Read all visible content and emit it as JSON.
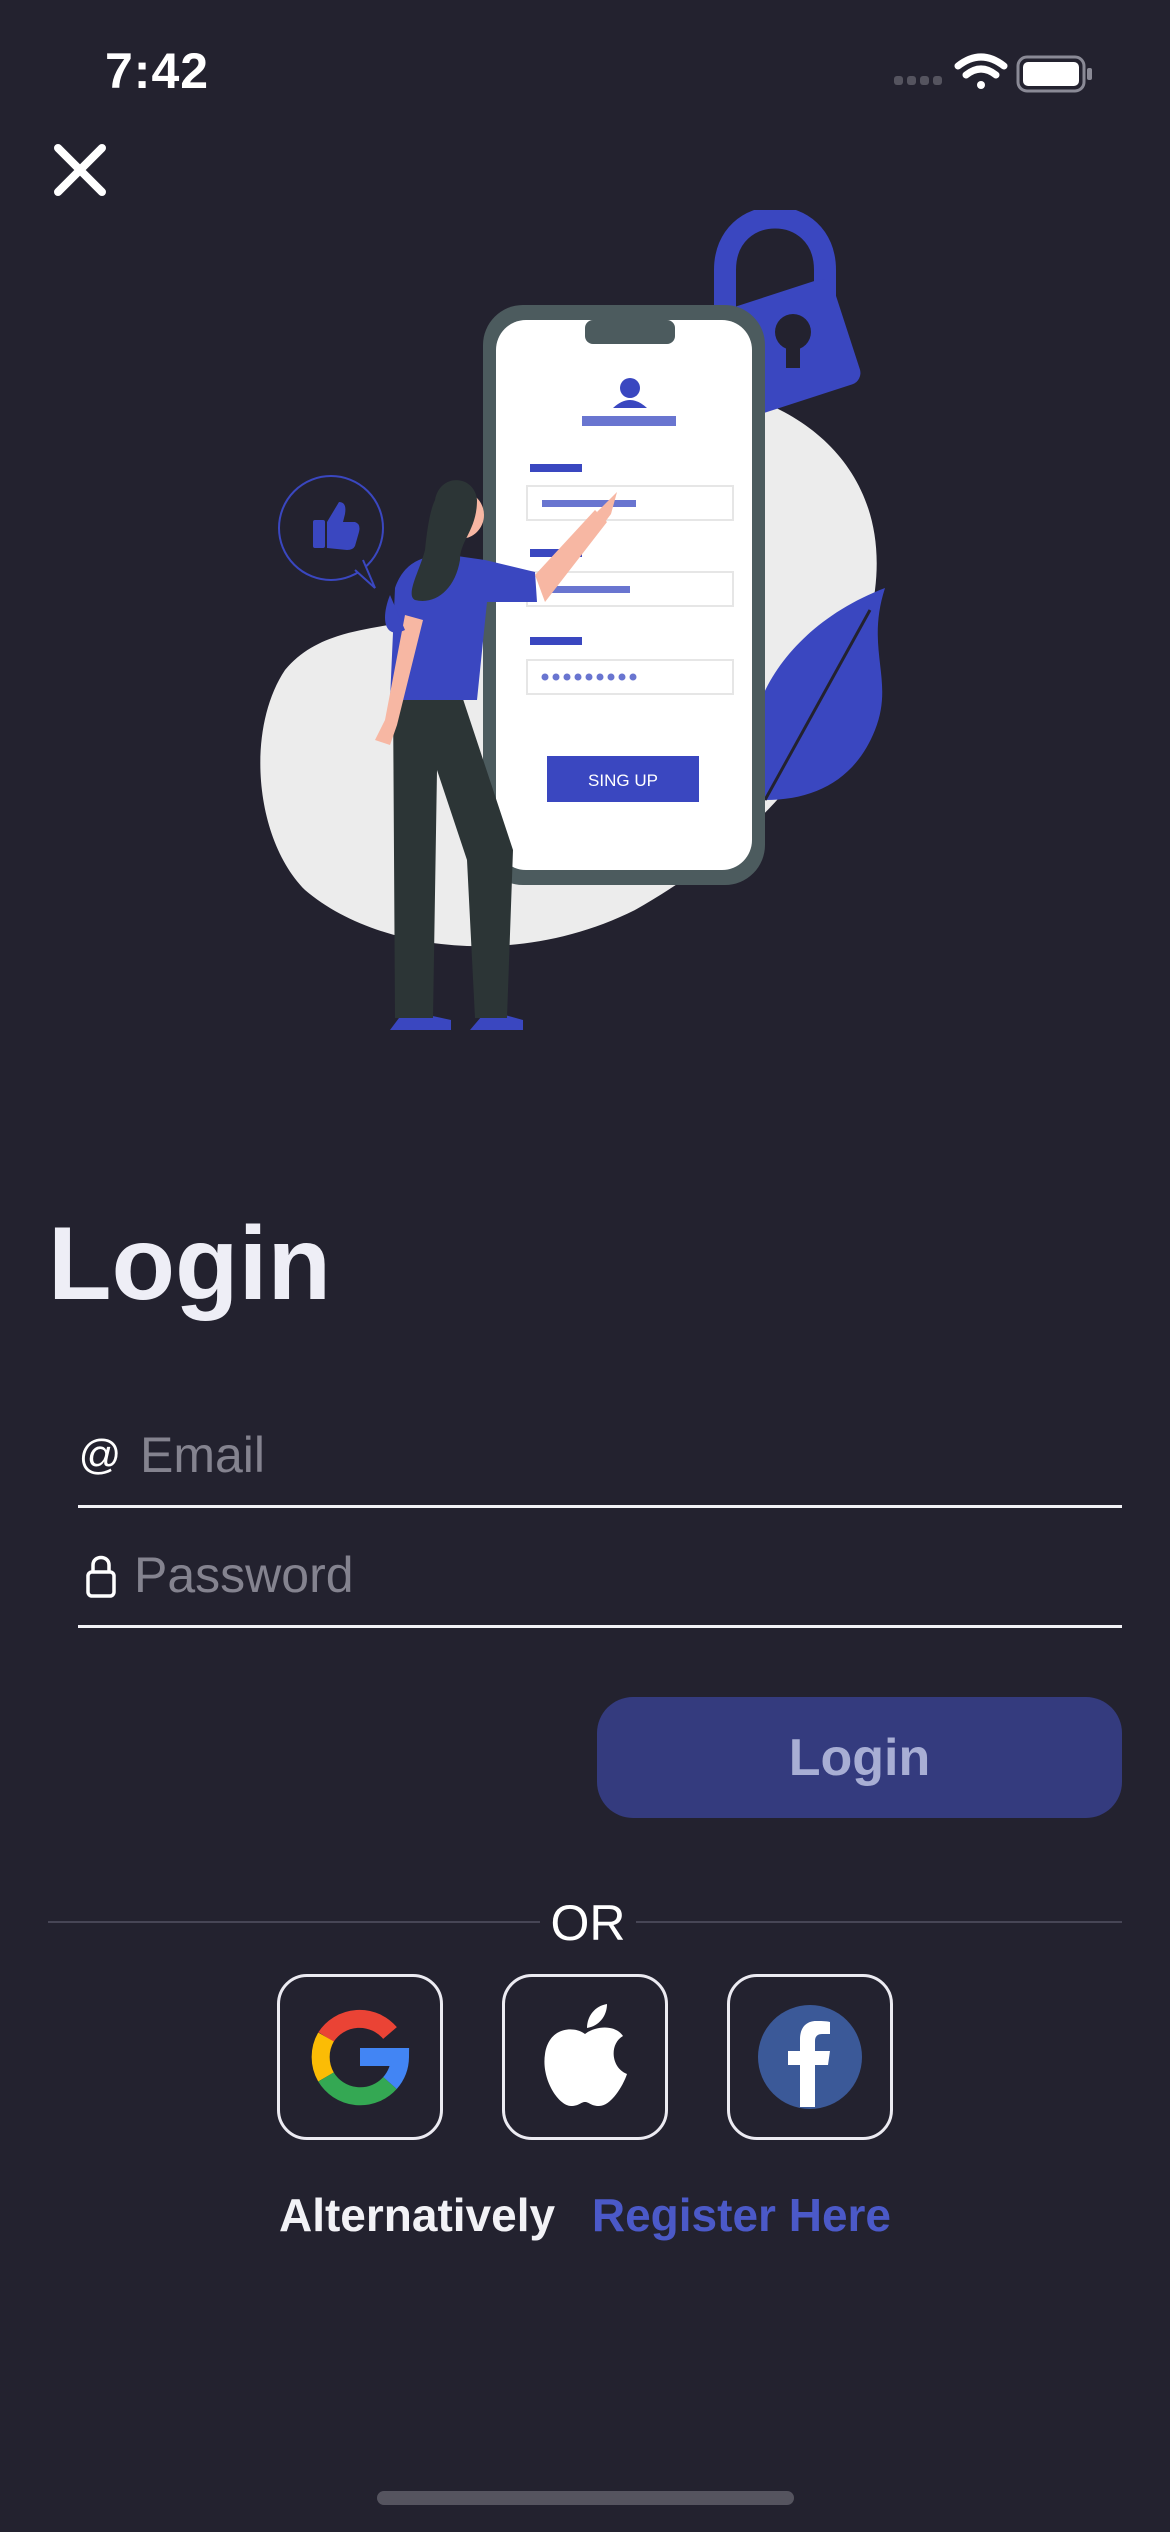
{
  "status_bar": {
    "time": "7:42",
    "icons": [
      "signal-icon",
      "wifi-icon",
      "battery-icon"
    ]
  },
  "illustration": {
    "button_label": "SING UP"
  },
  "page": {
    "title": "Login"
  },
  "form": {
    "email": {
      "icon": "at-icon",
      "placeholder": "Email",
      "value": ""
    },
    "password": {
      "icon": "lock-icon",
      "placeholder": "Password",
      "value": ""
    },
    "login_label": "Login"
  },
  "divider": {
    "text": "OR"
  },
  "social": [
    {
      "name": "google",
      "icon": "google-icon"
    },
    {
      "name": "apple",
      "icon": "apple-icon"
    },
    {
      "name": "facebook",
      "icon": "facebook-icon"
    }
  ],
  "footer": {
    "text": "Alternatively",
    "link": "Register Here"
  },
  "colors": {
    "background": "#23222f",
    "accent": "#4b59c8",
    "button": "#343b7e",
    "illustration_blue": "#3a47c0"
  }
}
